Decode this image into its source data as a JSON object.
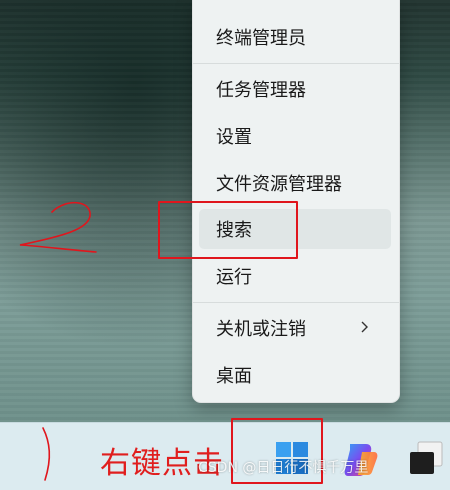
{
  "context_menu": {
    "items": [
      {
        "label": "终端管理员"
      },
      {
        "label": "任务管理器"
      },
      {
        "label": "设置"
      },
      {
        "label": "文件资源管理器"
      },
      {
        "label": "搜索"
      },
      {
        "label": "运行"
      },
      {
        "label": "关机或注销"
      },
      {
        "label": "桌面"
      }
    ]
  },
  "annotations": {
    "step_number": "2",
    "hint": "右键点击"
  },
  "taskbar": {
    "start_icon": "windows-start-icon",
    "copilot_icon": "copilot-icon",
    "app_icon": "app-icon"
  },
  "watermark": "CSDN @日日行不惧千万里",
  "colors": {
    "annotation_red": "#e0161d",
    "start_blue": "#1e90ff"
  }
}
